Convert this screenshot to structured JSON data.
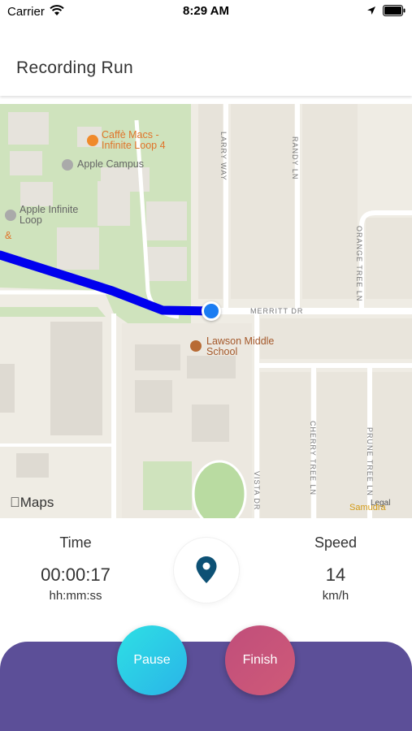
{
  "status_bar": {
    "carrier": "Carrier",
    "time": "8:29 AM"
  },
  "header": {
    "title": "Recording Run"
  },
  "map": {
    "pois": {
      "cafe": "Caffè Macs - Infinite Loop 4",
      "campus": "Apple Campus",
      "infinite_loop": "Apple Infinite Loop",
      "edge_char": "&",
      "school": "Lawson Middle School"
    },
    "streets": {
      "larry_way": "LARRY WAY",
      "randy_ln": "RANDY LN",
      "orange_tree_ln": "ORANGE TREE LN",
      "merritt_dr": "MERRITT DR",
      "cherry_tree_ln": "CHERRY TREE LN",
      "prune_tree_ln": "PRUNE TREE LN",
      "vista_dr": "VISTA DR"
    },
    "attribution": "Maps",
    "legal": "Legal",
    "samudra": "Samudra",
    "route_color": "#0000ee",
    "user_location_color": "#1a7cf2"
  },
  "stats": {
    "time_label": "Time",
    "time_value": "00:00:17",
    "time_unit": "hh:mm:ss",
    "speed_label": "Speed",
    "speed_value": "14",
    "speed_unit": "km/h"
  },
  "controls": {
    "pause_label": "Pause",
    "finish_label": "Finish",
    "panel_color": "#5c4f98",
    "center_icon": "location-pin-icon"
  }
}
